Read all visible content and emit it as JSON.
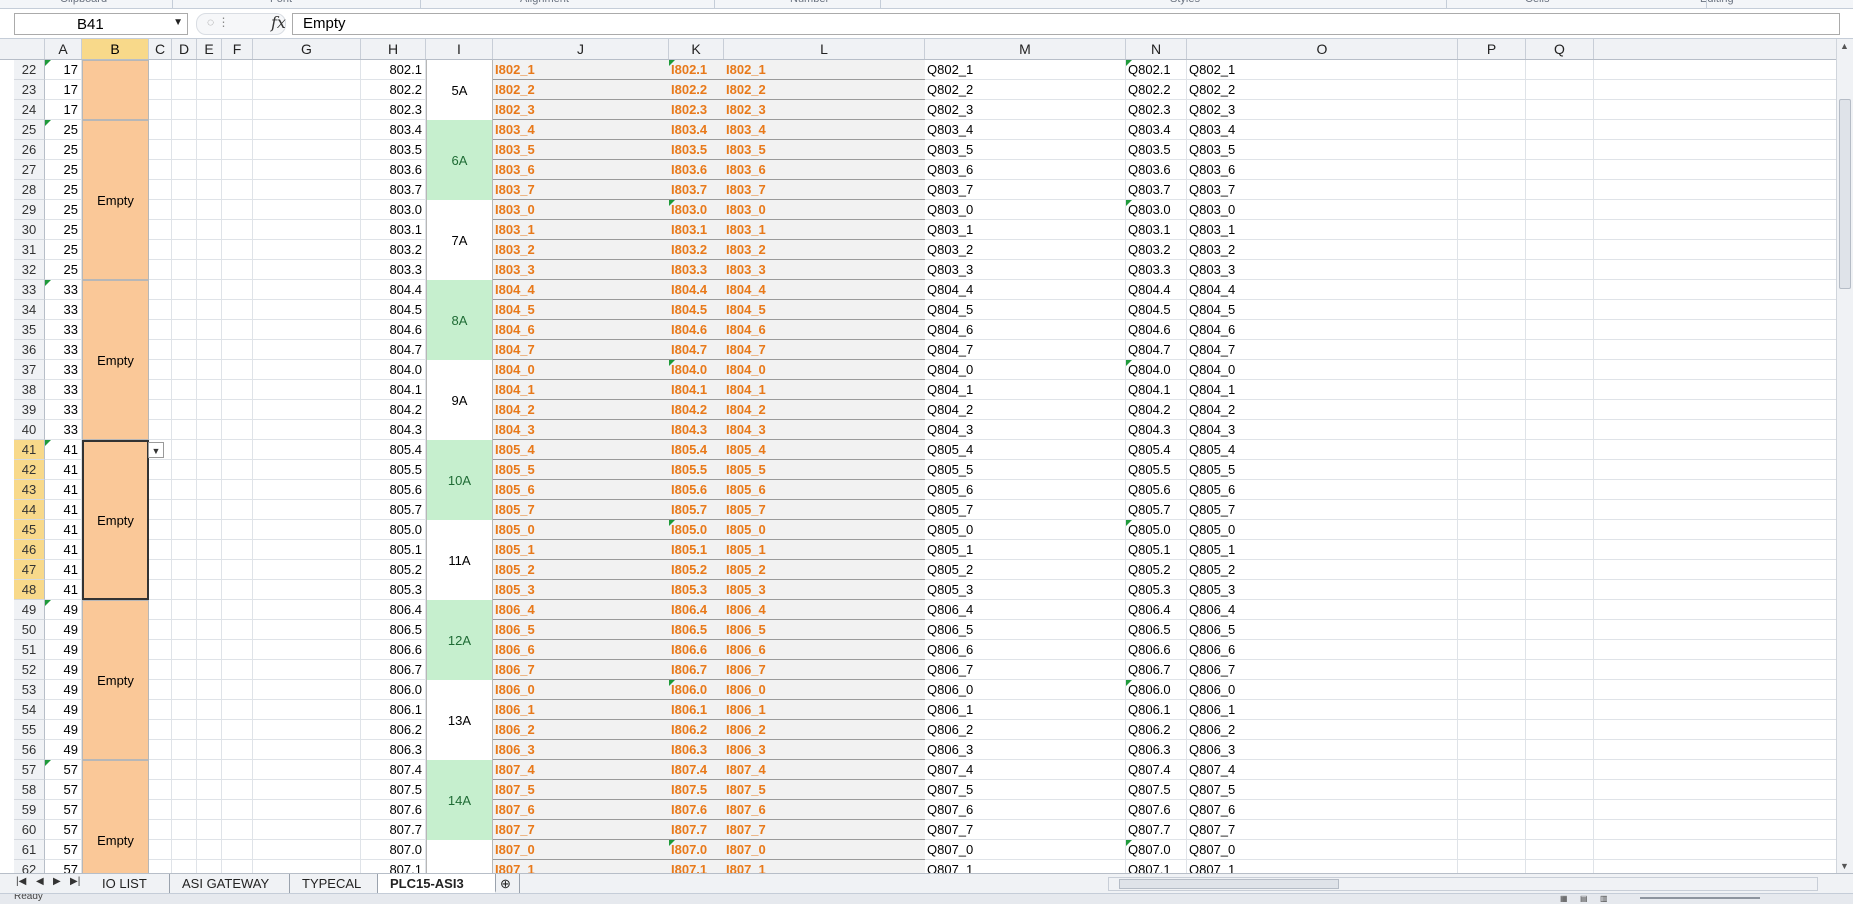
{
  "ribbon": {
    "groups": [
      "Clipboard",
      "Font",
      "Alignment",
      "Number",
      "Styles",
      "Cells",
      "Editing"
    ]
  },
  "formula_bar": {
    "name_box": "B41",
    "fx": "fx",
    "formula": "Empty"
  },
  "columns": [
    "A",
    "B",
    "C",
    "D",
    "E",
    "F",
    "G",
    "H",
    "I",
    "J",
    "K",
    "L",
    "M",
    "N",
    "O",
    "P",
    "Q"
  ],
  "rows": [
    {
      "r": "22",
      "a": "17",
      "h": "802.1",
      "j": "I802_1",
      "k": "I802.1",
      "l": "I802_1",
      "m": "Q802_1",
      "n": "Q802.1",
      "o": "Q802_1"
    },
    {
      "r": "23",
      "a": "17",
      "h": "802.2",
      "j": "I802_2",
      "k": "I802.2",
      "l": "I802_2",
      "m": "Q802_2",
      "n": "Q802.2",
      "o": "Q802_2"
    },
    {
      "r": "24",
      "a": "17",
      "h": "802.3",
      "j": "I802_3",
      "k": "I802.3",
      "l": "I802_3",
      "m": "Q802_3",
      "n": "Q802.3",
      "o": "Q802_3"
    },
    {
      "r": "25",
      "a": "25",
      "h": "803.4",
      "j": "I803_4",
      "k": "I803.4",
      "l": "I803_4",
      "m": "Q803_4",
      "n": "Q803.4",
      "o": "Q803_4"
    },
    {
      "r": "26",
      "a": "25",
      "h": "803.5",
      "j": "I803_5",
      "k": "I803.5",
      "l": "I803_5",
      "m": "Q803_5",
      "n": "Q803.5",
      "o": "Q803_5"
    },
    {
      "r": "27",
      "a": "25",
      "h": "803.6",
      "j": "I803_6",
      "k": "I803.6",
      "l": "I803_6",
      "m": "Q803_6",
      "n": "Q803.6",
      "o": "Q803_6"
    },
    {
      "r": "28",
      "a": "25",
      "h": "803.7",
      "j": "I803_7",
      "k": "I803.7",
      "l": "I803_7",
      "m": "Q803_7",
      "n": "Q803.7",
      "o": "Q803_7"
    },
    {
      "r": "29",
      "a": "25",
      "h": "803.0",
      "j": "I803_0",
      "k": "I803.0",
      "l": "I803_0",
      "m": "Q803_0",
      "n": "Q803.0",
      "o": "Q803_0"
    },
    {
      "r": "30",
      "a": "25",
      "h": "803.1",
      "j": "I803_1",
      "k": "I803.1",
      "l": "I803_1",
      "m": "Q803_1",
      "n": "Q803.1",
      "o": "Q803_1"
    },
    {
      "r": "31",
      "a": "25",
      "h": "803.2",
      "j": "I803_2",
      "k": "I803.2",
      "l": "I803_2",
      "m": "Q803_2",
      "n": "Q803.2",
      "o": "Q803_2"
    },
    {
      "r": "32",
      "a": "25",
      "h": "803.3",
      "j": "I803_3",
      "k": "I803.3",
      "l": "I803_3",
      "m": "Q803_3",
      "n": "Q803.3",
      "o": "Q803_3"
    },
    {
      "r": "33",
      "a": "33",
      "h": "804.4",
      "j": "I804_4",
      "k": "I804.4",
      "l": "I804_4",
      "m": "Q804_4",
      "n": "Q804.4",
      "o": "Q804_4"
    },
    {
      "r": "34",
      "a": "33",
      "h": "804.5",
      "j": "I804_5",
      "k": "I804.5",
      "l": "I804_5",
      "m": "Q804_5",
      "n": "Q804.5",
      "o": "Q804_5"
    },
    {
      "r": "35",
      "a": "33",
      "h": "804.6",
      "j": "I804_6",
      "k": "I804.6",
      "l": "I804_6",
      "m": "Q804_6",
      "n": "Q804.6",
      "o": "Q804_6"
    },
    {
      "r": "36",
      "a": "33",
      "h": "804.7",
      "j": "I804_7",
      "k": "I804.7",
      "l": "I804_7",
      "m": "Q804_7",
      "n": "Q804.7",
      "o": "Q804_7"
    },
    {
      "r": "37",
      "a": "33",
      "h": "804.0",
      "j": "I804_0",
      "k": "I804.0",
      "l": "I804_0",
      "m": "Q804_0",
      "n": "Q804.0",
      "o": "Q804_0"
    },
    {
      "r": "38",
      "a": "33",
      "h": "804.1",
      "j": "I804_1",
      "k": "I804.1",
      "l": "I804_1",
      "m": "Q804_1",
      "n": "Q804.1",
      "o": "Q804_1"
    },
    {
      "r": "39",
      "a": "33",
      "h": "804.2",
      "j": "I804_2",
      "k": "I804.2",
      "l": "I804_2",
      "m": "Q804_2",
      "n": "Q804.2",
      "o": "Q804_2"
    },
    {
      "r": "40",
      "a": "33",
      "h": "804.3",
      "j": "I804_3",
      "k": "I804.3",
      "l": "I804_3",
      "m": "Q804_3",
      "n": "Q804.3",
      "o": "Q804_3"
    },
    {
      "r": "41",
      "a": "41",
      "h": "805.4",
      "j": "I805_4",
      "k": "I805.4",
      "l": "I805_4",
      "m": "Q805_4",
      "n": "Q805.4",
      "o": "Q805_4"
    },
    {
      "r": "42",
      "a": "41",
      "h": "805.5",
      "j": "I805_5",
      "k": "I805.5",
      "l": "I805_5",
      "m": "Q805_5",
      "n": "Q805.5",
      "o": "Q805_5"
    },
    {
      "r": "43",
      "a": "41",
      "h": "805.6",
      "j": "I805_6",
      "k": "I805.6",
      "l": "I805_6",
      "m": "Q805_6",
      "n": "Q805.6",
      "o": "Q805_6"
    },
    {
      "r": "44",
      "a": "41",
      "h": "805.7",
      "j": "I805_7",
      "k": "I805.7",
      "l": "I805_7",
      "m": "Q805_7",
      "n": "Q805.7",
      "o": "Q805_7"
    },
    {
      "r": "45",
      "a": "41",
      "h": "805.0",
      "j": "I805_0",
      "k": "I805.0",
      "l": "I805_0",
      "m": "Q805_0",
      "n": "Q805.0",
      "o": "Q805_0"
    },
    {
      "r": "46",
      "a": "41",
      "h": "805.1",
      "j": "I805_1",
      "k": "I805.1",
      "l": "I805_1",
      "m": "Q805_1",
      "n": "Q805.1",
      "o": "Q805_1"
    },
    {
      "r": "47",
      "a": "41",
      "h": "805.2",
      "j": "I805_2",
      "k": "I805.2",
      "l": "I805_2",
      "m": "Q805_2",
      "n": "Q805.2",
      "o": "Q805_2"
    },
    {
      "r": "48",
      "a": "41",
      "h": "805.3",
      "j": "I805_3",
      "k": "I805.3",
      "l": "I805_3",
      "m": "Q805_3",
      "n": "Q805.3",
      "o": "Q805_3"
    },
    {
      "r": "49",
      "a": "49",
      "h": "806.4",
      "j": "I806_4",
      "k": "I806.4",
      "l": "I806_4",
      "m": "Q806_4",
      "n": "Q806.4",
      "o": "Q806_4"
    },
    {
      "r": "50",
      "a": "49",
      "h": "806.5",
      "j": "I806_5",
      "k": "I806.5",
      "l": "I806_5",
      "m": "Q806_5",
      "n": "Q806.5",
      "o": "Q806_5"
    },
    {
      "r": "51",
      "a": "49",
      "h": "806.6",
      "j": "I806_6",
      "k": "I806.6",
      "l": "I806_6",
      "m": "Q806_6",
      "n": "Q806.6",
      "o": "Q806_6"
    },
    {
      "r": "52",
      "a": "49",
      "h": "806.7",
      "j": "I806_7",
      "k": "I806.7",
      "l": "I806_7",
      "m": "Q806_7",
      "n": "Q806.7",
      "o": "Q806_7"
    },
    {
      "r": "53",
      "a": "49",
      "h": "806.0",
      "j": "I806_0",
      "k": "I806.0",
      "l": "I806_0",
      "m": "Q806_0",
      "n": "Q806.0",
      "o": "Q806_0"
    },
    {
      "r": "54",
      "a": "49",
      "h": "806.1",
      "j": "I806_1",
      "k": "I806.1",
      "l": "I806_1",
      "m": "Q806_1",
      "n": "Q806.1",
      "o": "Q806_1"
    },
    {
      "r": "55",
      "a": "49",
      "h": "806.2",
      "j": "I806_2",
      "k": "I806.2",
      "l": "I806_2",
      "m": "Q806_2",
      "n": "Q806.2",
      "o": "Q806_2"
    },
    {
      "r": "56",
      "a": "49",
      "h": "806.3",
      "j": "I806_3",
      "k": "I806.3",
      "l": "I806_3",
      "m": "Q806_3",
      "n": "Q806.3",
      "o": "Q806_3"
    },
    {
      "r": "57",
      "a": "57",
      "h": "807.4",
      "j": "I807_4",
      "k": "I807.4",
      "l": "I807_4",
      "m": "Q807_4",
      "n": "Q807.4",
      "o": "Q807_4"
    },
    {
      "r": "58",
      "a": "57",
      "h": "807.5",
      "j": "I807_5",
      "k": "I807.5",
      "l": "I807_5",
      "m": "Q807_5",
      "n": "Q807.5",
      "o": "Q807_5"
    },
    {
      "r": "59",
      "a": "57",
      "h": "807.6",
      "j": "I807_6",
      "k": "I807.6",
      "l": "I807_6",
      "m": "Q807_6",
      "n": "Q807.6",
      "o": "Q807_6"
    },
    {
      "r": "60",
      "a": "57",
      "h": "807.7",
      "j": "I807_7",
      "k": "I807.7",
      "l": "I807_7",
      "m": "Q807_7",
      "n": "Q807.7",
      "o": "Q807_7"
    },
    {
      "r": "61",
      "a": "57",
      "h": "807.0",
      "j": "I807_0",
      "k": "I807.0",
      "l": "I807_0",
      "m": "Q807_0",
      "n": "Q807.0",
      "o": "Q807_0"
    },
    {
      "r": "62",
      "a": "57",
      "h": "807.1",
      "j": "I807_1",
      "k": "I807.1",
      "l": "I807_1",
      "m": "Q807_1",
      "n": "Q807.1",
      "o": "Q807_1"
    }
  ],
  "b_blocks": [
    {
      "label": "",
      "first_row": "22",
      "last_row": "24",
      "active": false
    },
    {
      "label": "Empty",
      "first_row": "25",
      "last_row": "32",
      "active": false
    },
    {
      "label": "Empty",
      "first_row": "33",
      "last_row": "40",
      "active": false
    },
    {
      "label": "Empty",
      "first_row": "41",
      "last_row": "48",
      "active": true
    },
    {
      "label": "Empty",
      "first_row": "49",
      "last_row": "56",
      "active": false
    },
    {
      "label": "Empty",
      "first_row": "57",
      "last_row": "64",
      "active": false
    }
  ],
  "i_groups": [
    {
      "label": "5A",
      "first_row": "22",
      "last_row": "24",
      "green": false
    },
    {
      "label": "6A",
      "first_row": "25",
      "last_row": "28",
      "green": true
    },
    {
      "label": "7A",
      "first_row": "29",
      "last_row": "32",
      "green": false
    },
    {
      "label": "8A",
      "first_row": "33",
      "last_row": "36",
      "green": true
    },
    {
      "label": "9A",
      "first_row": "37",
      "last_row": "40",
      "green": false
    },
    {
      "label": "10A",
      "first_row": "41",
      "last_row": "44",
      "green": true
    },
    {
      "label": "11A",
      "first_row": "45",
      "last_row": "48",
      "green": false
    },
    {
      "label": "12A",
      "first_row": "49",
      "last_row": "52",
      "green": true
    },
    {
      "label": "13A",
      "first_row": "53",
      "last_row": "56",
      "green": false
    },
    {
      "label": "14A",
      "first_row": "57",
      "last_row": "60",
      "green": true
    },
    {
      "label": "",
      "first_row": "61",
      "last_row": "64",
      "green": false
    }
  ],
  "selected_cell": {
    "column": "B",
    "first_row": "41",
    "last_row": "48"
  },
  "sheet_tabs": [
    "IO LIST",
    "ASI GATEWAY",
    "TYPECAL",
    "PLC15-ASI3"
  ],
  "active_tab": "PLC15-ASI3",
  "status_bar": {
    "text": "Ready"
  },
  "icons": {
    "insert_sheet": "insert-worksheet-icon",
    "nav_first": "first-sheet-icon",
    "nav_prev": "prev-sheet-icon",
    "nav_next": "next-sheet-icon",
    "nav_last": "last-sheet-icon"
  },
  "colors": {
    "b_block_fill": "#fac898",
    "i_group_green": "#c6efce",
    "orange_text": "#e8791a",
    "selected_header": "#f8d98a"
  }
}
